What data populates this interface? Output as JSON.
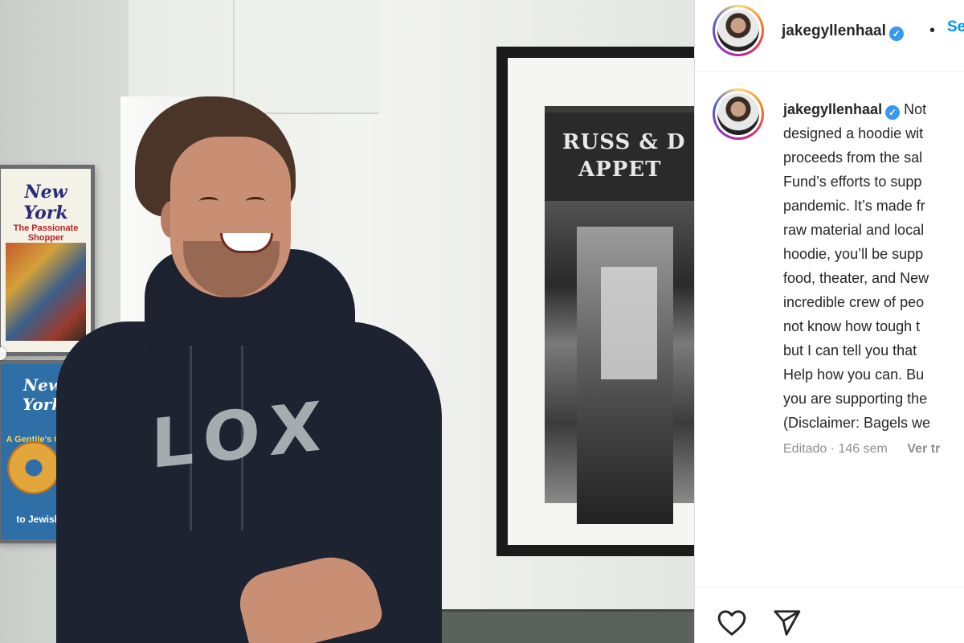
{
  "post": {
    "username": "jakegyllenhaal",
    "follow_label": "Seguir",
    "caption_lines": [
      "Not",
      "designed a hoodie wit",
      "proceeds from the sal",
      "Fund’s efforts to supp",
      "pandemic. It’s made fr",
      "raw material and local",
      "hoodie, you’ll be supp",
      "food, theater, and New",
      "incredible crew of peo",
      "not know how tough t",
      "but I can tell you that",
      "Help how you can. Bu",
      "you are supporting the",
      "(Disclaimer: Bagels we"
    ],
    "edited_label": "Editado",
    "age": "146 sem",
    "translate_label": "Ver tr"
  },
  "photo": {
    "shirt_text": "LOX",
    "sign_text": [
      "RUSS & D",
      "APPET"
    ],
    "poster1_masthead": "New York",
    "poster1_subtitle": "The Passionate Shopper",
    "poster2_masthead": "New York",
    "poster2_subtitle": "A Gentile's Guide",
    "poster2_footer": "to Jewish F"
  },
  "icons": {
    "verified": "verified-badge-icon",
    "like": "heart-icon",
    "share": "send-icon"
  },
  "colors": {
    "accent": "#0095f6",
    "verified": "#3897f0",
    "text": "#262626",
    "muted": "#8e8e8e"
  }
}
